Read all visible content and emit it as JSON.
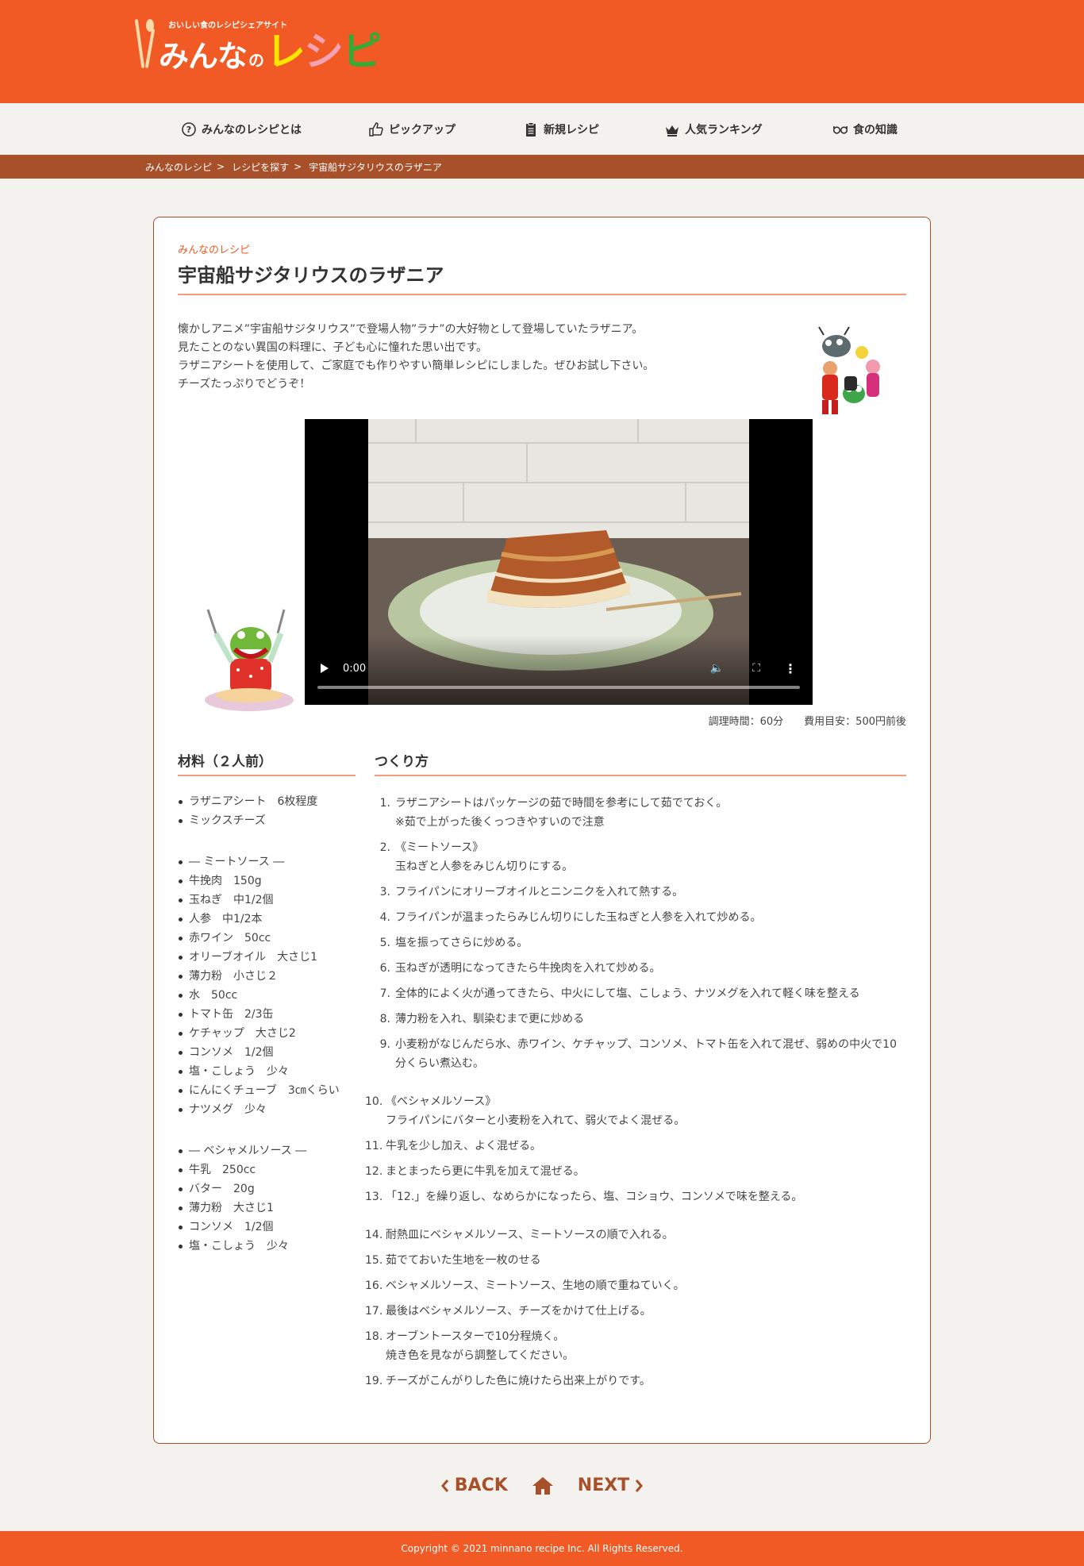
{
  "header": {
    "tagline": "おいしい食のレシピシェアサイト",
    "logo_minna": "みんな",
    "logo_no": "の",
    "logo_re": "レ",
    "logo_shi": "シ",
    "logo_pi": "ピ",
    "bg_color": "#f15a24"
  },
  "nav": {
    "items": [
      {
        "label": "みんなのレシピとは",
        "icon": "question-circle-icon"
      },
      {
        "label": "ピックアップ",
        "icon": "thumbs-up-icon"
      },
      {
        "label": "新規レシピ",
        "icon": "clipboard-icon"
      },
      {
        "label": "人気ランキング",
        "icon": "crown-icon"
      },
      {
        "label": "食の知識",
        "icon": "glasses-icon"
      }
    ]
  },
  "breadcrumb": {
    "items": [
      "みんなのレシピ",
      "レシピを探す",
      "宇宙船サジタリウスのラザニア"
    ],
    "sep": ">"
  },
  "recipe": {
    "site_label": "みんなのレシピ",
    "title": "宇宙船サジタリウスのラザニア",
    "intro": [
      "懐かしアニメ”宇宙船サジタリウス”で登場人物”ラナ”の大好物として登場していたラザニア。",
      "見たことのない異国の料理に、子ども心に憧れた思い出です。",
      "ラザニアシートを使用して、ご家庭でも作りやすい簡単レシピにしました。ぜひお試し下さい。",
      "チーズたっぷりでどうぞ！"
    ],
    "video": {
      "time": "0:00",
      "progress": 0
    },
    "cook_time": "調理時間：60分",
    "cost": "費用目安：500円前後",
    "ingredients_head": "材料（２人前）",
    "ingredients": [
      "ラザニアシート　6枚程度",
      "ミックスチーズ",
      "",
      "― ミートソース ―",
      "牛挽肉　150g",
      "玉ねぎ　中1/2個",
      "人参　中1/2本",
      "赤ワイン　50cc",
      "オリーブオイル　大さじ1",
      "薄力粉　小さじ２",
      "水　50cc",
      "トマト缶　2/3缶",
      "ケチャップ　大さじ2",
      "コンソメ　1/2個",
      "塩・こしょう　少々",
      "にんにくチューブ　3㎝くらい",
      "ナツメグ　少々",
      "",
      "― ベシャメルソース ―",
      "牛乳　250cc",
      "バター　20g",
      "薄力粉　大さじ1",
      "コンソメ　1/2個",
      "塩・こしょう　少々"
    ],
    "steps_head": "つくり方",
    "steps": [
      {
        "num": "1.",
        "text": "ラザニアシートはパッケージの茹で時間を参考にして茹でておく。\n※茹で上がった後くっつきやすいので注意"
      },
      {
        "num": "2.",
        "text": "《ミートソース》\n玉ねぎと人参をみじん切りにする。"
      },
      {
        "num": "3.",
        "text": "フライパンにオリーブオイルとニンニクを入れて熱する。"
      },
      {
        "num": "4.",
        "text": "フライパンが温まったらみじん切りにした玉ねぎと人参を入れて炒める。"
      },
      {
        "num": "5.",
        "text": "塩を振ってさらに炒める。"
      },
      {
        "num": "6.",
        "text": "玉ねぎが透明になってきたら牛挽肉を入れて炒める。"
      },
      {
        "num": "7.",
        "text": "全体的によく火が通ってきたら、中火にして塩、こしょう、ナツメグを入れて軽く味を整える"
      },
      {
        "num": "8.",
        "text": "薄力粉を入れ、馴染むまで更に炒める"
      },
      {
        "num": "9.",
        "text": "小麦粉がなじんだら水、赤ワイン、ケチャップ、コンソメ、トマト缶を入れて混ぜ、弱めの中火で10分くらい煮込む。"
      },
      {
        "num": "10.",
        "text": "《ベシャメルソース》\nフライパンにバターと小麦粉を入れて、弱火でよく混ぜる。"
      },
      {
        "num": "11.",
        "text": "牛乳を少し加え、よく混ぜる。"
      },
      {
        "num": "12.",
        "text": "まとまったら更に牛乳を加えて混ぜる。"
      },
      {
        "num": "13.",
        "text": "「12.」を繰り返し、なめらかになったら、塩、コショウ、コンソメで味を整える。"
      },
      {
        "num": "14.",
        "text": "耐熱皿にベシャメルソース、ミートソースの順で入れる。"
      },
      {
        "num": "15.",
        "text": "茹でておいた生地を一枚のせる"
      },
      {
        "num": "16.",
        "text": "ベシャメルソース、ミートソース、生地の順で重ねていく。"
      },
      {
        "num": "17.",
        "text": "最後はベシャメルソース、チーズをかけて仕上げる。"
      },
      {
        "num": "18.",
        "text": "オーブントースターで10分程焼く。\n焼き色を見ながら調整してください。"
      },
      {
        "num": "19.",
        "text": "チーズがこんがりした色に焼けたら出来上がりです。"
      }
    ]
  },
  "pager": {
    "back": "BACK",
    "next": "NEXT",
    "color": "#a8502a"
  },
  "footer": {
    "copyright": "Copyright © 2021 minnano recipe Inc. All Rights Reserved."
  }
}
